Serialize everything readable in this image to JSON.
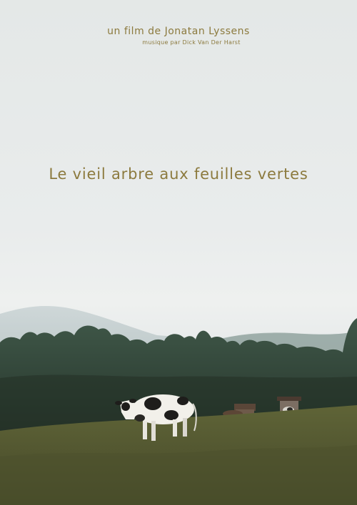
{
  "poster": {
    "credit": "un film de Jonatan Lyssens",
    "music_credit": "musique par Dick Van Der Harst",
    "title": "Le vieil arbre aux feuilles vertes"
  },
  "colors": {
    "text_accent": "#8c7a3e",
    "sky": "#e8ebea",
    "tree_dark": "#2f4236",
    "meadow": "#4f5230"
  }
}
